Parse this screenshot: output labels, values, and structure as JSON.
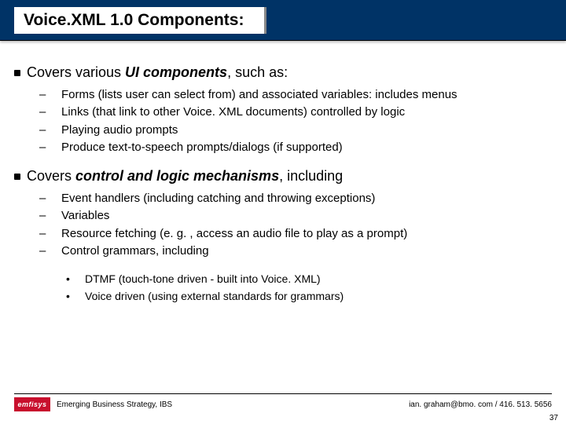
{
  "title": "Voice.XML 1.0 Components:",
  "sections": [
    {
      "lead_pre": "Covers various ",
      "lead_bold": "UI components",
      "lead_post": ", such as:",
      "items": [
        "Forms (lists user can select from) and associated variables: includes menus",
        "Links (that link to other Voice. XML documents) controlled by logic",
        "Playing audio prompts",
        "Produce text-to-speech prompts/dialogs (if supported)"
      ]
    },
    {
      "lead_pre": "Covers ",
      "lead_bold": "control and logic mechanisms",
      "lead_post": ", including",
      "items": [
        "Event handlers  (including catching and throwing exceptions)",
        "Variables",
        "Resource fetching (e. g. , access an audio file to play as a prompt)",
        "Control grammars, including"
      ],
      "subitems": [
        "DTMF (touch-tone driven - built into Voice. XML)",
        "Voice driven (using external standards for grammars)"
      ]
    }
  ],
  "footer": {
    "logo": "emfisys",
    "org": "Emerging Business Strategy, IBS",
    "contact": "ian. graham@bmo. com / 416. 513. 5656",
    "page": "37"
  }
}
